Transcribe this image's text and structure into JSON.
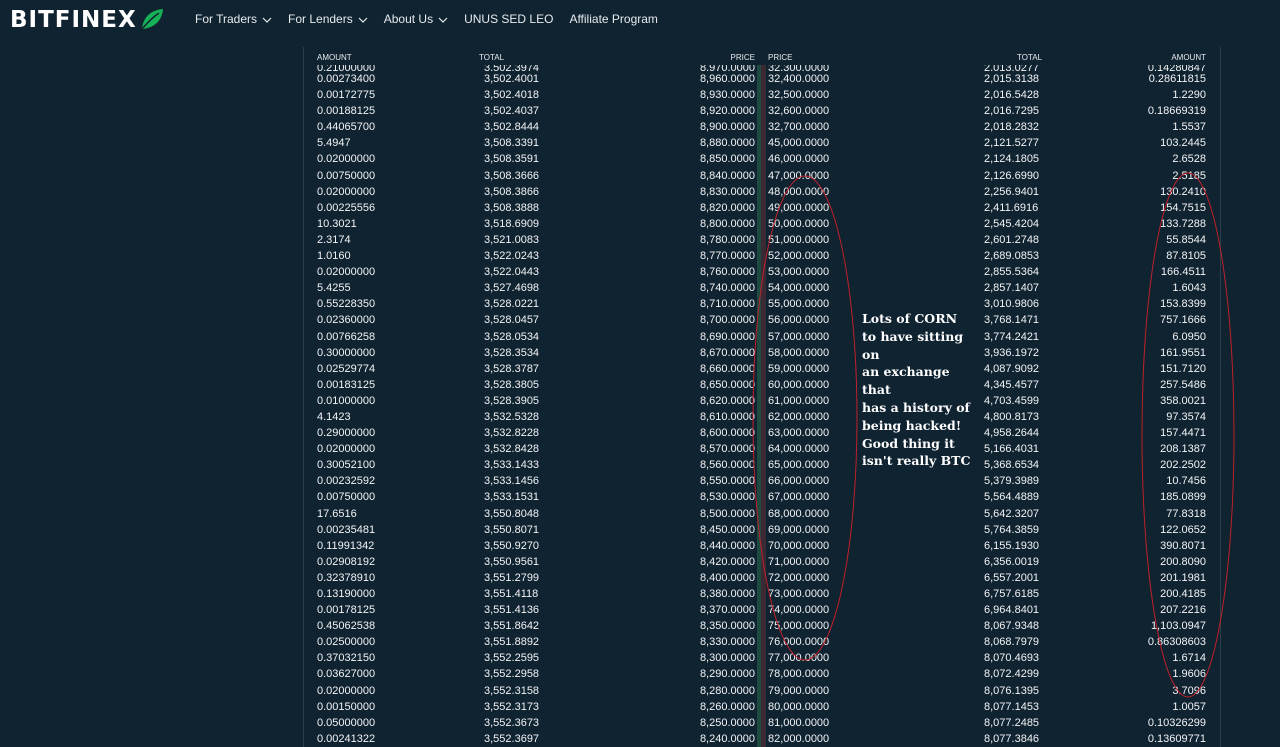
{
  "nav": {
    "logo_text": "BITFINEX",
    "brand_color": "#16b157",
    "items": [
      {
        "label": "For Traders",
        "has_dropdown": true
      },
      {
        "label": "For Lenders",
        "has_dropdown": true
      },
      {
        "label": "About Us",
        "has_dropdown": true
      },
      {
        "label": "UNUS SED LEO",
        "has_dropdown": false
      },
      {
        "label": "Affiliate Program",
        "has_dropdown": false
      }
    ]
  },
  "orderbook": {
    "headers": {
      "bid_amount": "AMOUNT",
      "bid_total": "TOTAL",
      "bid_price": "PRICE",
      "ask_price": "PRICE",
      "ask_total": "TOTAL",
      "ask_amount": "AMOUNT"
    },
    "top_partial_row": {
      "bid_amount": "0.21000000",
      "bid_total": "3,502.3974",
      "bid_price": "8,970.0000",
      "ask_price": "32,300.0000",
      "ask_total": "2,013.0277",
      "ask_amount": "0.14280847"
    },
    "rows": [
      {
        "bid_amount": "0.00273400",
        "bid_total": "3,502.4001",
        "bid_price": "8,960.0000",
        "ask_price": "32,400.0000",
        "ask_total": "2,015.3138",
        "ask_amount": "0.28611815"
      },
      {
        "bid_amount": "0.00172775",
        "bid_total": "3,502.4018",
        "bid_price": "8,930.0000",
        "ask_price": "32,500.0000",
        "ask_total": "2,016.5428",
        "ask_amount": "1.2290"
      },
      {
        "bid_amount": "0.00188125",
        "bid_total": "3,502.4037",
        "bid_price": "8,920.0000",
        "ask_price": "32,600.0000",
        "ask_total": "2,016.7295",
        "ask_amount": "0.18669319"
      },
      {
        "bid_amount": "0.44065700",
        "bid_total": "3,502.8444",
        "bid_price": "8,900.0000",
        "ask_price": "32,700.0000",
        "ask_total": "2,018.2832",
        "ask_amount": "1.5537"
      },
      {
        "bid_amount": "5.4947",
        "bid_total": "3,508.3391",
        "bid_price": "8,880.0000",
        "ask_price": "45,000.0000",
        "ask_total": "2,121.5277",
        "ask_amount": "103.2445"
      },
      {
        "bid_amount": "0.02000000",
        "bid_total": "3,508.3591",
        "bid_price": "8,850.0000",
        "ask_price": "46,000.0000",
        "ask_total": "2,124.1805",
        "ask_amount": "2.6528"
      },
      {
        "bid_amount": "0.00750000",
        "bid_total": "3,508.3666",
        "bid_price": "8,840.0000",
        "ask_price": "47,000.0000",
        "ask_total": "2,126.6990",
        "ask_amount": "2.5185"
      },
      {
        "bid_amount": "0.02000000",
        "bid_total": "3,508.3866",
        "bid_price": "8,830.0000",
        "ask_price": "48,000.0000",
        "ask_total": "2,256.9401",
        "ask_amount": "130.2410"
      },
      {
        "bid_amount": "0.00225556",
        "bid_total": "3,508.3888",
        "bid_price": "8,820.0000",
        "ask_price": "49,000.0000",
        "ask_total": "2,411.6916",
        "ask_amount": "154.7515"
      },
      {
        "bid_amount": "10.3021",
        "bid_total": "3,518.6909",
        "bid_price": "8,800.0000",
        "ask_price": "50,000.0000",
        "ask_total": "2,545.4204",
        "ask_amount": "133.7288"
      },
      {
        "bid_amount": "2.3174",
        "bid_total": "3,521.0083",
        "bid_price": "8,780.0000",
        "ask_price": "51,000.0000",
        "ask_total": "2,601.2748",
        "ask_amount": "55.8544"
      },
      {
        "bid_amount": "1.0160",
        "bid_total": "3,522.0243",
        "bid_price": "8,770.0000",
        "ask_price": "52,000.0000",
        "ask_total": "2,689.0853",
        "ask_amount": "87.8105"
      },
      {
        "bid_amount": "0.02000000",
        "bid_total": "3,522.0443",
        "bid_price": "8,760.0000",
        "ask_price": "53,000.0000",
        "ask_total": "2,855.5364",
        "ask_amount": "166.4511"
      },
      {
        "bid_amount": "5.4255",
        "bid_total": "3,527.4698",
        "bid_price": "8,740.0000",
        "ask_price": "54,000.0000",
        "ask_total": "2,857.1407",
        "ask_amount": "1.6043"
      },
      {
        "bid_amount": "0.55228350",
        "bid_total": "3,528.0221",
        "bid_price": "8,710.0000",
        "ask_price": "55,000.0000",
        "ask_total": "3,010.9806",
        "ask_amount": "153.8399"
      },
      {
        "bid_amount": "0.02360000",
        "bid_total": "3,528.0457",
        "bid_price": "8,700.0000",
        "ask_price": "56,000.0000",
        "ask_total": "3,768.1471",
        "ask_amount": "757.1666"
      },
      {
        "bid_amount": "0.00766258",
        "bid_total": "3,528.0534",
        "bid_price": "8,690.0000",
        "ask_price": "57,000.0000",
        "ask_total": "3,774.2421",
        "ask_amount": "6.0950"
      },
      {
        "bid_amount": "0.30000000",
        "bid_total": "3,528.3534",
        "bid_price": "8,670.0000",
        "ask_price": "58,000.0000",
        "ask_total": "3,936.1972",
        "ask_amount": "161.9551"
      },
      {
        "bid_amount": "0.02529774",
        "bid_total": "3,528.3787",
        "bid_price": "8,660.0000",
        "ask_price": "59,000.0000",
        "ask_total": "4,087.9092",
        "ask_amount": "151.7120"
      },
      {
        "bid_amount": "0.00183125",
        "bid_total": "3,528.3805",
        "bid_price": "8,650.0000",
        "ask_price": "60,000.0000",
        "ask_total": "4,345.4577",
        "ask_amount": "257.5486"
      },
      {
        "bid_amount": "0.01000000",
        "bid_total": "3,528.3905",
        "bid_price": "8,620.0000",
        "ask_price": "61,000.0000",
        "ask_total": "4,703.4599",
        "ask_amount": "358.0021"
      },
      {
        "bid_amount": "4.1423",
        "bid_total": "3,532.5328",
        "bid_price": "8,610.0000",
        "ask_price": "62,000.0000",
        "ask_total": "4,800.8173",
        "ask_amount": "97.3574"
      },
      {
        "bid_amount": "0.29000000",
        "bid_total": "3,532.8228",
        "bid_price": "8,600.0000",
        "ask_price": "63,000.0000",
        "ask_total": "4,958.2644",
        "ask_amount": "157.4471"
      },
      {
        "bid_amount": "0.02000000",
        "bid_total": "3,532.8428",
        "bid_price": "8,570.0000",
        "ask_price": "64,000.0000",
        "ask_total": "5,166.4031",
        "ask_amount": "208.1387"
      },
      {
        "bid_amount": "0.30052100",
        "bid_total": "3,533.1433",
        "bid_price": "8,560.0000",
        "ask_price": "65,000.0000",
        "ask_total": "5,368.6534",
        "ask_amount": "202.2502"
      },
      {
        "bid_amount": "0.00232592",
        "bid_total": "3,533.1456",
        "bid_price": "8,550.0000",
        "ask_price": "66,000.0000",
        "ask_total": "5,379.3989",
        "ask_amount": "10.7456"
      },
      {
        "bid_amount": "0.00750000",
        "bid_total": "3,533.1531",
        "bid_price": "8,530.0000",
        "ask_price": "67,000.0000",
        "ask_total": "5,564.4889",
        "ask_amount": "185.0899"
      },
      {
        "bid_amount": "17.6516",
        "bid_total": "3,550.8048",
        "bid_price": "8,500.0000",
        "ask_price": "68,000.0000",
        "ask_total": "5,642.3207",
        "ask_amount": "77.8318"
      },
      {
        "bid_amount": "0.00235481",
        "bid_total": "3,550.8071",
        "bid_price": "8,450.0000",
        "ask_price": "69,000.0000",
        "ask_total": "5,764.3859",
        "ask_amount": "122.0652"
      },
      {
        "bid_amount": "0.11991342",
        "bid_total": "3,550.9270",
        "bid_price": "8,440.0000",
        "ask_price": "70,000.0000",
        "ask_total": "6,155.1930",
        "ask_amount": "390.8071"
      },
      {
        "bid_amount": "0.02908192",
        "bid_total": "3,550.9561",
        "bid_price": "8,420.0000",
        "ask_price": "71,000.0000",
        "ask_total": "6,356.0019",
        "ask_amount": "200.8090"
      },
      {
        "bid_amount": "0.32378910",
        "bid_total": "3,551.2799",
        "bid_price": "8,400.0000",
        "ask_price": "72,000.0000",
        "ask_total": "6,557.2001",
        "ask_amount": "201.1981"
      },
      {
        "bid_amount": "0.13190000",
        "bid_total": "3,551.4118",
        "bid_price": "8,380.0000",
        "ask_price": "73,000.0000",
        "ask_total": "6,757.6185",
        "ask_amount": "200.4185"
      },
      {
        "bid_amount": "0.00178125",
        "bid_total": "3,551.4136",
        "bid_price": "8,370.0000",
        "ask_price": "74,000.0000",
        "ask_total": "6,964.8401",
        "ask_amount": "207.2216"
      },
      {
        "bid_amount": "0.45062538",
        "bid_total": "3,551.8642",
        "bid_price": "8,350.0000",
        "ask_price": "75,000.0000",
        "ask_total": "8,067.9348",
        "ask_amount": "1,103.0947"
      },
      {
        "bid_amount": "0.02500000",
        "bid_total": "3,551.8892",
        "bid_price": "8,330.0000",
        "ask_price": "76,000.0000",
        "ask_total": "8,068.7979",
        "ask_amount": "0.86308603"
      },
      {
        "bid_amount": "0.37032150",
        "bid_total": "3,552.2595",
        "bid_price": "8,300.0000",
        "ask_price": "77,000.0000",
        "ask_total": "8,070.4693",
        "ask_amount": "1.6714"
      },
      {
        "bid_amount": "0.03627000",
        "bid_total": "3,552.2958",
        "bid_price": "8,290.0000",
        "ask_price": "78,000.0000",
        "ask_total": "8,072.4299",
        "ask_amount": "1.9606"
      },
      {
        "bid_amount": "0.02000000",
        "bid_total": "3,552.3158",
        "bid_price": "8,280.0000",
        "ask_price": "79,000.0000",
        "ask_total": "8,076.1395",
        "ask_amount": "3.7096"
      },
      {
        "bid_amount": "0.00150000",
        "bid_total": "3,552.3173",
        "bid_price": "8,260.0000",
        "ask_price": "80,000.0000",
        "ask_total": "8,077.1453",
        "ask_amount": "1.0057"
      },
      {
        "bid_amount": "0.05000000",
        "bid_total": "3,552.3673",
        "bid_price": "8,250.0000",
        "ask_price": "81,000.0000",
        "ask_total": "8,077.2485",
        "ask_amount": "0.10326299"
      },
      {
        "bid_amount": "0.00241322",
        "bid_total": "3,552.3697",
        "bid_price": "8,240.0000",
        "ask_price": "82,000.0000",
        "ask_total": "8,077.3846",
        "ask_amount": "0.13609771"
      }
    ]
  },
  "annotation": {
    "lines": [
      "Lots of CORN",
      "to have sitting on",
      "an exchange that",
      "has a history of",
      "being hacked!",
      "Good thing it",
      "isn't really BTC"
    ],
    "oval_color": "#c0202a"
  }
}
